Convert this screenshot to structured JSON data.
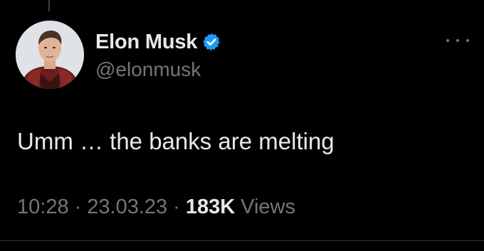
{
  "author": {
    "display_name": "Elon Musk",
    "handle": "@elonmusk",
    "verified": true,
    "verified_color": "#1d9bf0"
  },
  "tweet": {
    "text": "Umm … the banks are melting",
    "time": "10:28",
    "date": "23.03.23",
    "separator": "·",
    "views_count": "183K",
    "views_label": "Views"
  },
  "icons": {
    "avatar": "profile-photo",
    "verified": "verified-badge-icon",
    "more": "more-options-icon"
  },
  "colors": {
    "background": "#000000",
    "primary_text": "#e7e9ea",
    "secondary_text": "#71767b"
  }
}
